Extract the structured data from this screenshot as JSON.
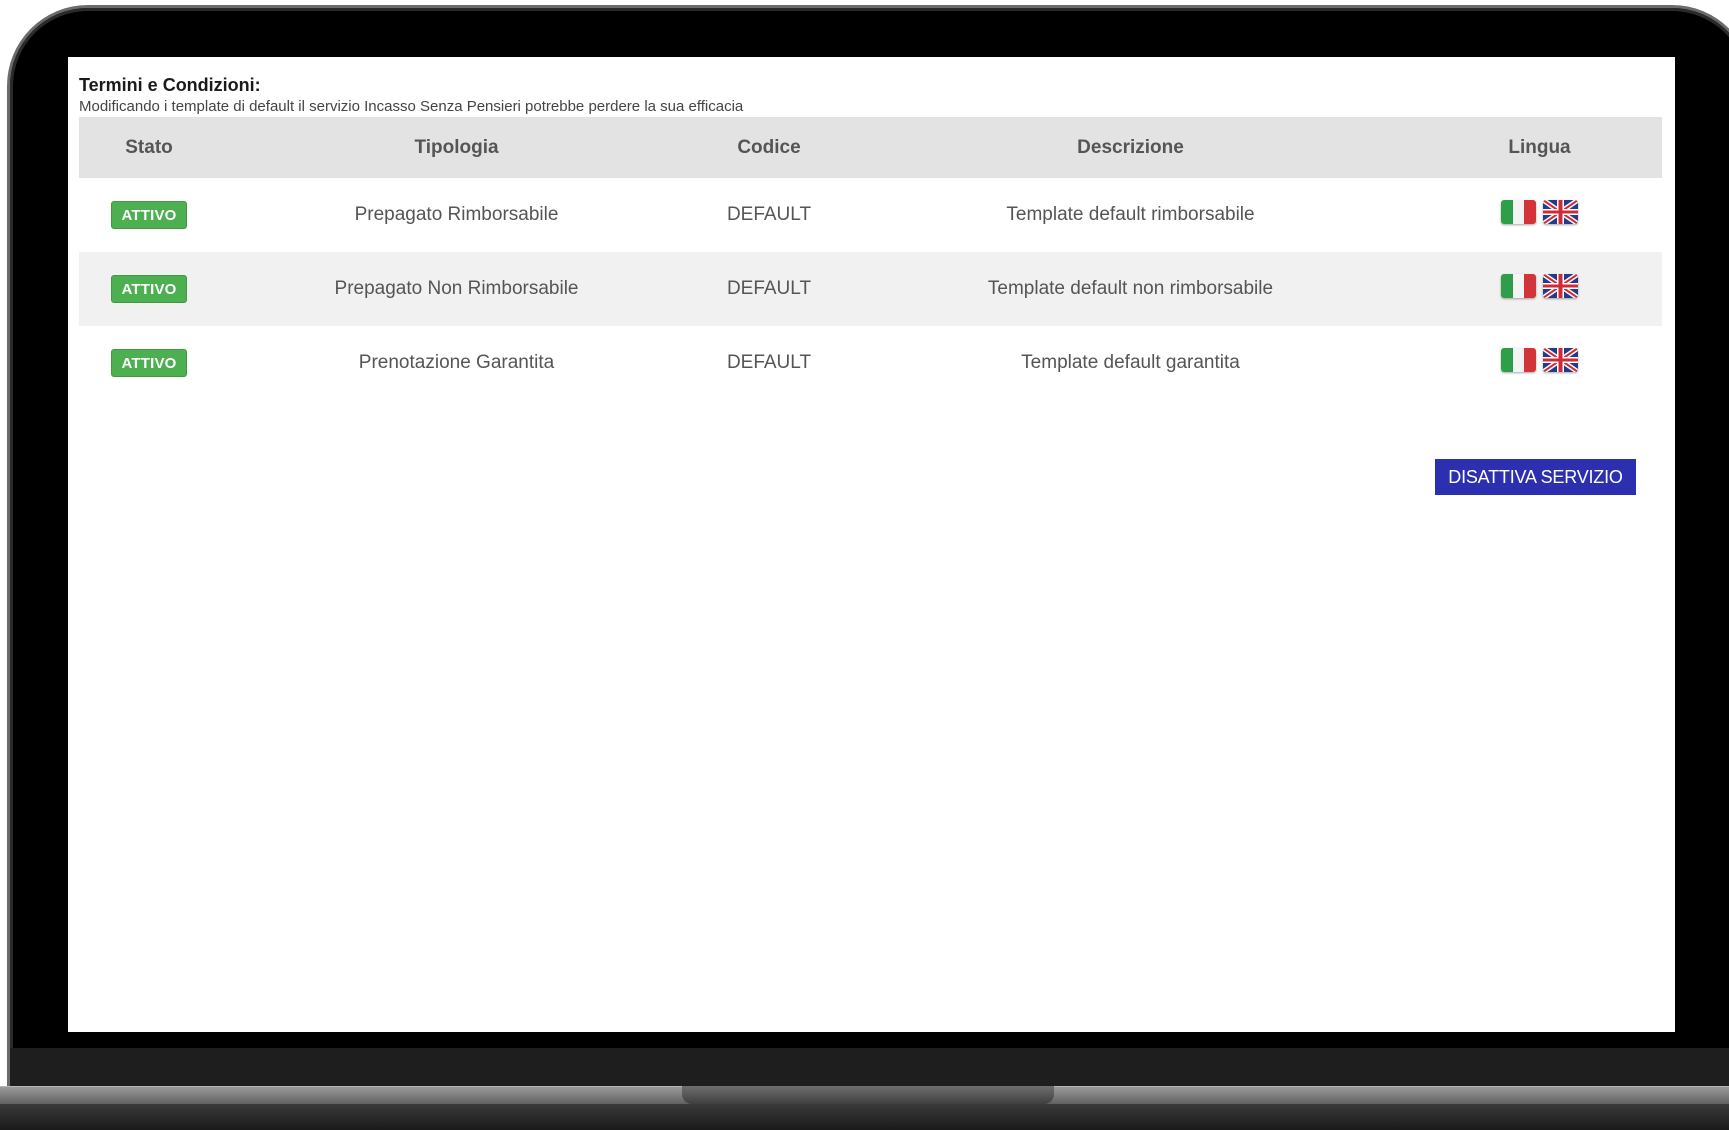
{
  "section": {
    "title": "Termini e Condizioni:",
    "subtitle": "Modificando i template di default il servizio Incasso Senza Pensieri potrebbe perdere la sua efficacia"
  },
  "table": {
    "headers": {
      "stato": "Stato",
      "tipologia": "Tipologia",
      "codice": "Codice",
      "descrizione": "Descrizione",
      "lingua": "Lingua"
    },
    "rows": [
      {
        "stato": "ATTIVO",
        "tipologia": "Prepagato Rimborsabile",
        "codice": "DEFAULT",
        "descrizione": "Template default rimborsabile",
        "lingue": [
          "italian-flag-icon",
          "uk-flag-icon"
        ]
      },
      {
        "stato": "ATTIVO",
        "tipologia": "Prepagato Non Rimborsabile",
        "codice": "DEFAULT",
        "descrizione": "Template default non rimborsabile",
        "lingue": [
          "italian-flag-icon",
          "uk-flag-icon"
        ]
      },
      {
        "stato": "ATTIVO",
        "tipologia": "Prenotazione Garantita",
        "codice": "DEFAULT",
        "descrizione": "Template default garantita",
        "lingue": [
          "italian-flag-icon",
          "uk-flag-icon"
        ]
      }
    ]
  },
  "actions": {
    "disable_service_label": "DISATTIVA SERVIZIO"
  },
  "colors": {
    "status_active": "#4caf50",
    "primary_button": "#2b2fb0",
    "header_bg": "#e3e3e3",
    "alt_row_bg": "#f1f1f1"
  }
}
